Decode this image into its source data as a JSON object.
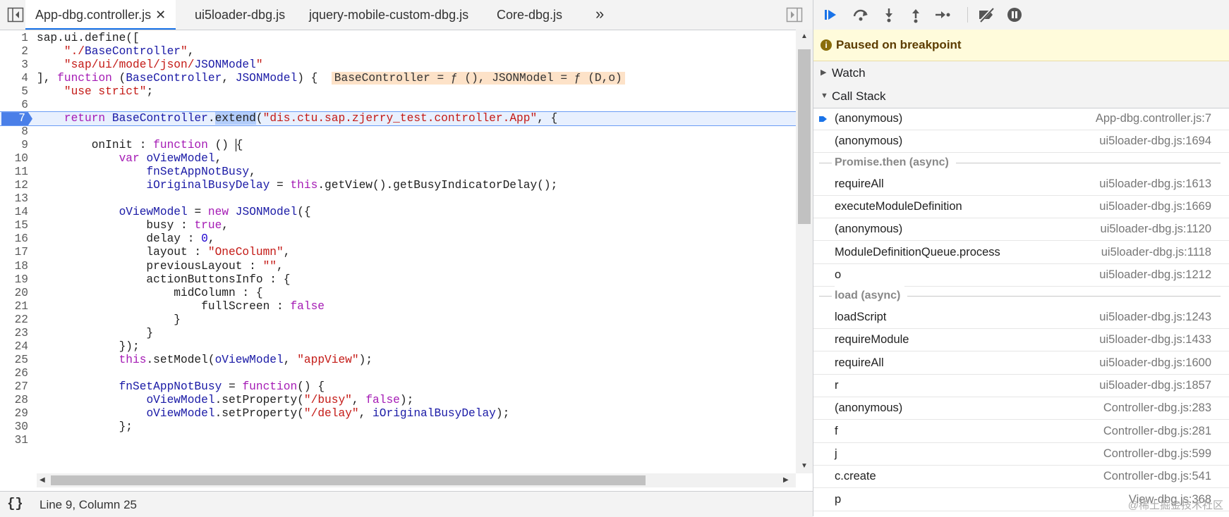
{
  "editor": {
    "tabs": [
      {
        "label": "App-dbg.controller.js",
        "active": true
      },
      {
        "label": "ui5loader-dbg.js"
      },
      {
        "label": "jquery-mobile-custom-dbg.js"
      },
      {
        "label": "Core-dbg.js"
      }
    ],
    "more_tabs": "»",
    "close_glyph": "✕",
    "lines": [
      {
        "n": "1",
        "code": "sap.ui.define(["
      },
      {
        "n": "2",
        "code": "    \"./BaseController\","
      },
      {
        "n": "3",
        "code": "    \"sap/ui/model/json/JSONModel\""
      },
      {
        "n": "4",
        "code": "], function (BaseController, JSONModel) {",
        "inline": "BaseController = ƒ (), JSONModel = ƒ (D,o)"
      },
      {
        "n": "5",
        "code": "    \"use strict\";"
      },
      {
        "n": "6",
        "code": ""
      },
      {
        "n": "7",
        "code": "    return BaseController.extend(\"dis.ctu.sap.zjerry_test.controller.App\", {",
        "breakpoint": true
      },
      {
        "n": "8",
        "code": ""
      },
      {
        "n": "9",
        "code": "        onInit : function () {"
      },
      {
        "n": "10",
        "code": "            var oViewModel,"
      },
      {
        "n": "11",
        "code": "                fnSetAppNotBusy,"
      },
      {
        "n": "12",
        "code": "                iOriginalBusyDelay = this.getView().getBusyIndicatorDelay();"
      },
      {
        "n": "13",
        "code": ""
      },
      {
        "n": "14",
        "code": "            oViewModel = new JSONModel({"
      },
      {
        "n": "15",
        "code": "                busy : true,"
      },
      {
        "n": "16",
        "code": "                delay : 0,"
      },
      {
        "n": "17",
        "code": "                layout : \"OneColumn\","
      },
      {
        "n": "18",
        "code": "                previousLayout : \"\","
      },
      {
        "n": "19",
        "code": "                actionButtonsInfo : {"
      },
      {
        "n": "20",
        "code": "                    midColumn : {"
      },
      {
        "n": "21",
        "code": "                        fullScreen : false"
      },
      {
        "n": "22",
        "code": "                    }"
      },
      {
        "n": "23",
        "code": "                }"
      },
      {
        "n": "24",
        "code": "            });"
      },
      {
        "n": "25",
        "code": "            this.setModel(oViewModel, \"appView\");"
      },
      {
        "n": "26",
        "code": ""
      },
      {
        "n": "27",
        "code": "            fnSetAppNotBusy = function() {"
      },
      {
        "n": "28",
        "code": "                oViewModel.setProperty(\"/busy\", false);"
      },
      {
        "n": "29",
        "code": "                oViewModel.setProperty(\"/delay\", iOriginalBusyDelay);"
      },
      {
        "n": "30",
        "code": "            };"
      },
      {
        "n": "31",
        "code": ""
      }
    ]
  },
  "status": {
    "pretty_print": "{}",
    "cursor": "Line 9, Column 25"
  },
  "debugger": {
    "toolbar": [
      "resume-icon",
      "step-over-icon",
      "step-into-icon",
      "step-out-icon",
      "step-icon",
      "deactivate-breakpoints-icon",
      "pause-on-exceptions-icon"
    ],
    "paused_text": "Paused on breakpoint",
    "watch_label": "Watch",
    "callstack_label": "Call Stack",
    "frames": [
      {
        "fn": "(anonymous)",
        "loc": "App-dbg.controller.js:7",
        "current": true
      },
      {
        "fn": "(anonymous)",
        "loc": "ui5loader-dbg.js:1694"
      },
      {
        "async": "Promise.then (async)"
      },
      {
        "fn": "requireAll",
        "loc": "ui5loader-dbg.js:1613"
      },
      {
        "fn": "executeModuleDefinition",
        "loc": "ui5loader-dbg.js:1669"
      },
      {
        "fn": "(anonymous)",
        "loc": "ui5loader-dbg.js:1120"
      },
      {
        "fn": "ModuleDefinitionQueue.process",
        "loc": "ui5loader-dbg.js:1118"
      },
      {
        "fn": "o",
        "loc": "ui5loader-dbg.js:1212"
      },
      {
        "async": "load (async)"
      },
      {
        "fn": "loadScript",
        "loc": "ui5loader-dbg.js:1243"
      },
      {
        "fn": "requireModule",
        "loc": "ui5loader-dbg.js:1433"
      },
      {
        "fn": "requireAll",
        "loc": "ui5loader-dbg.js:1600"
      },
      {
        "fn": "r",
        "loc": "ui5loader-dbg.js:1857"
      },
      {
        "fn": "(anonymous)",
        "loc": "Controller-dbg.js:283"
      },
      {
        "fn": "f",
        "loc": "Controller-dbg.js:281"
      },
      {
        "fn": "j",
        "loc": "Controller-dbg.js:599"
      },
      {
        "fn": "c.create",
        "loc": "Controller-dbg.js:541"
      },
      {
        "fn": "p",
        "loc": "View-dbg.js:368"
      }
    ],
    "watermark": "@稀土掘金技术社区"
  }
}
